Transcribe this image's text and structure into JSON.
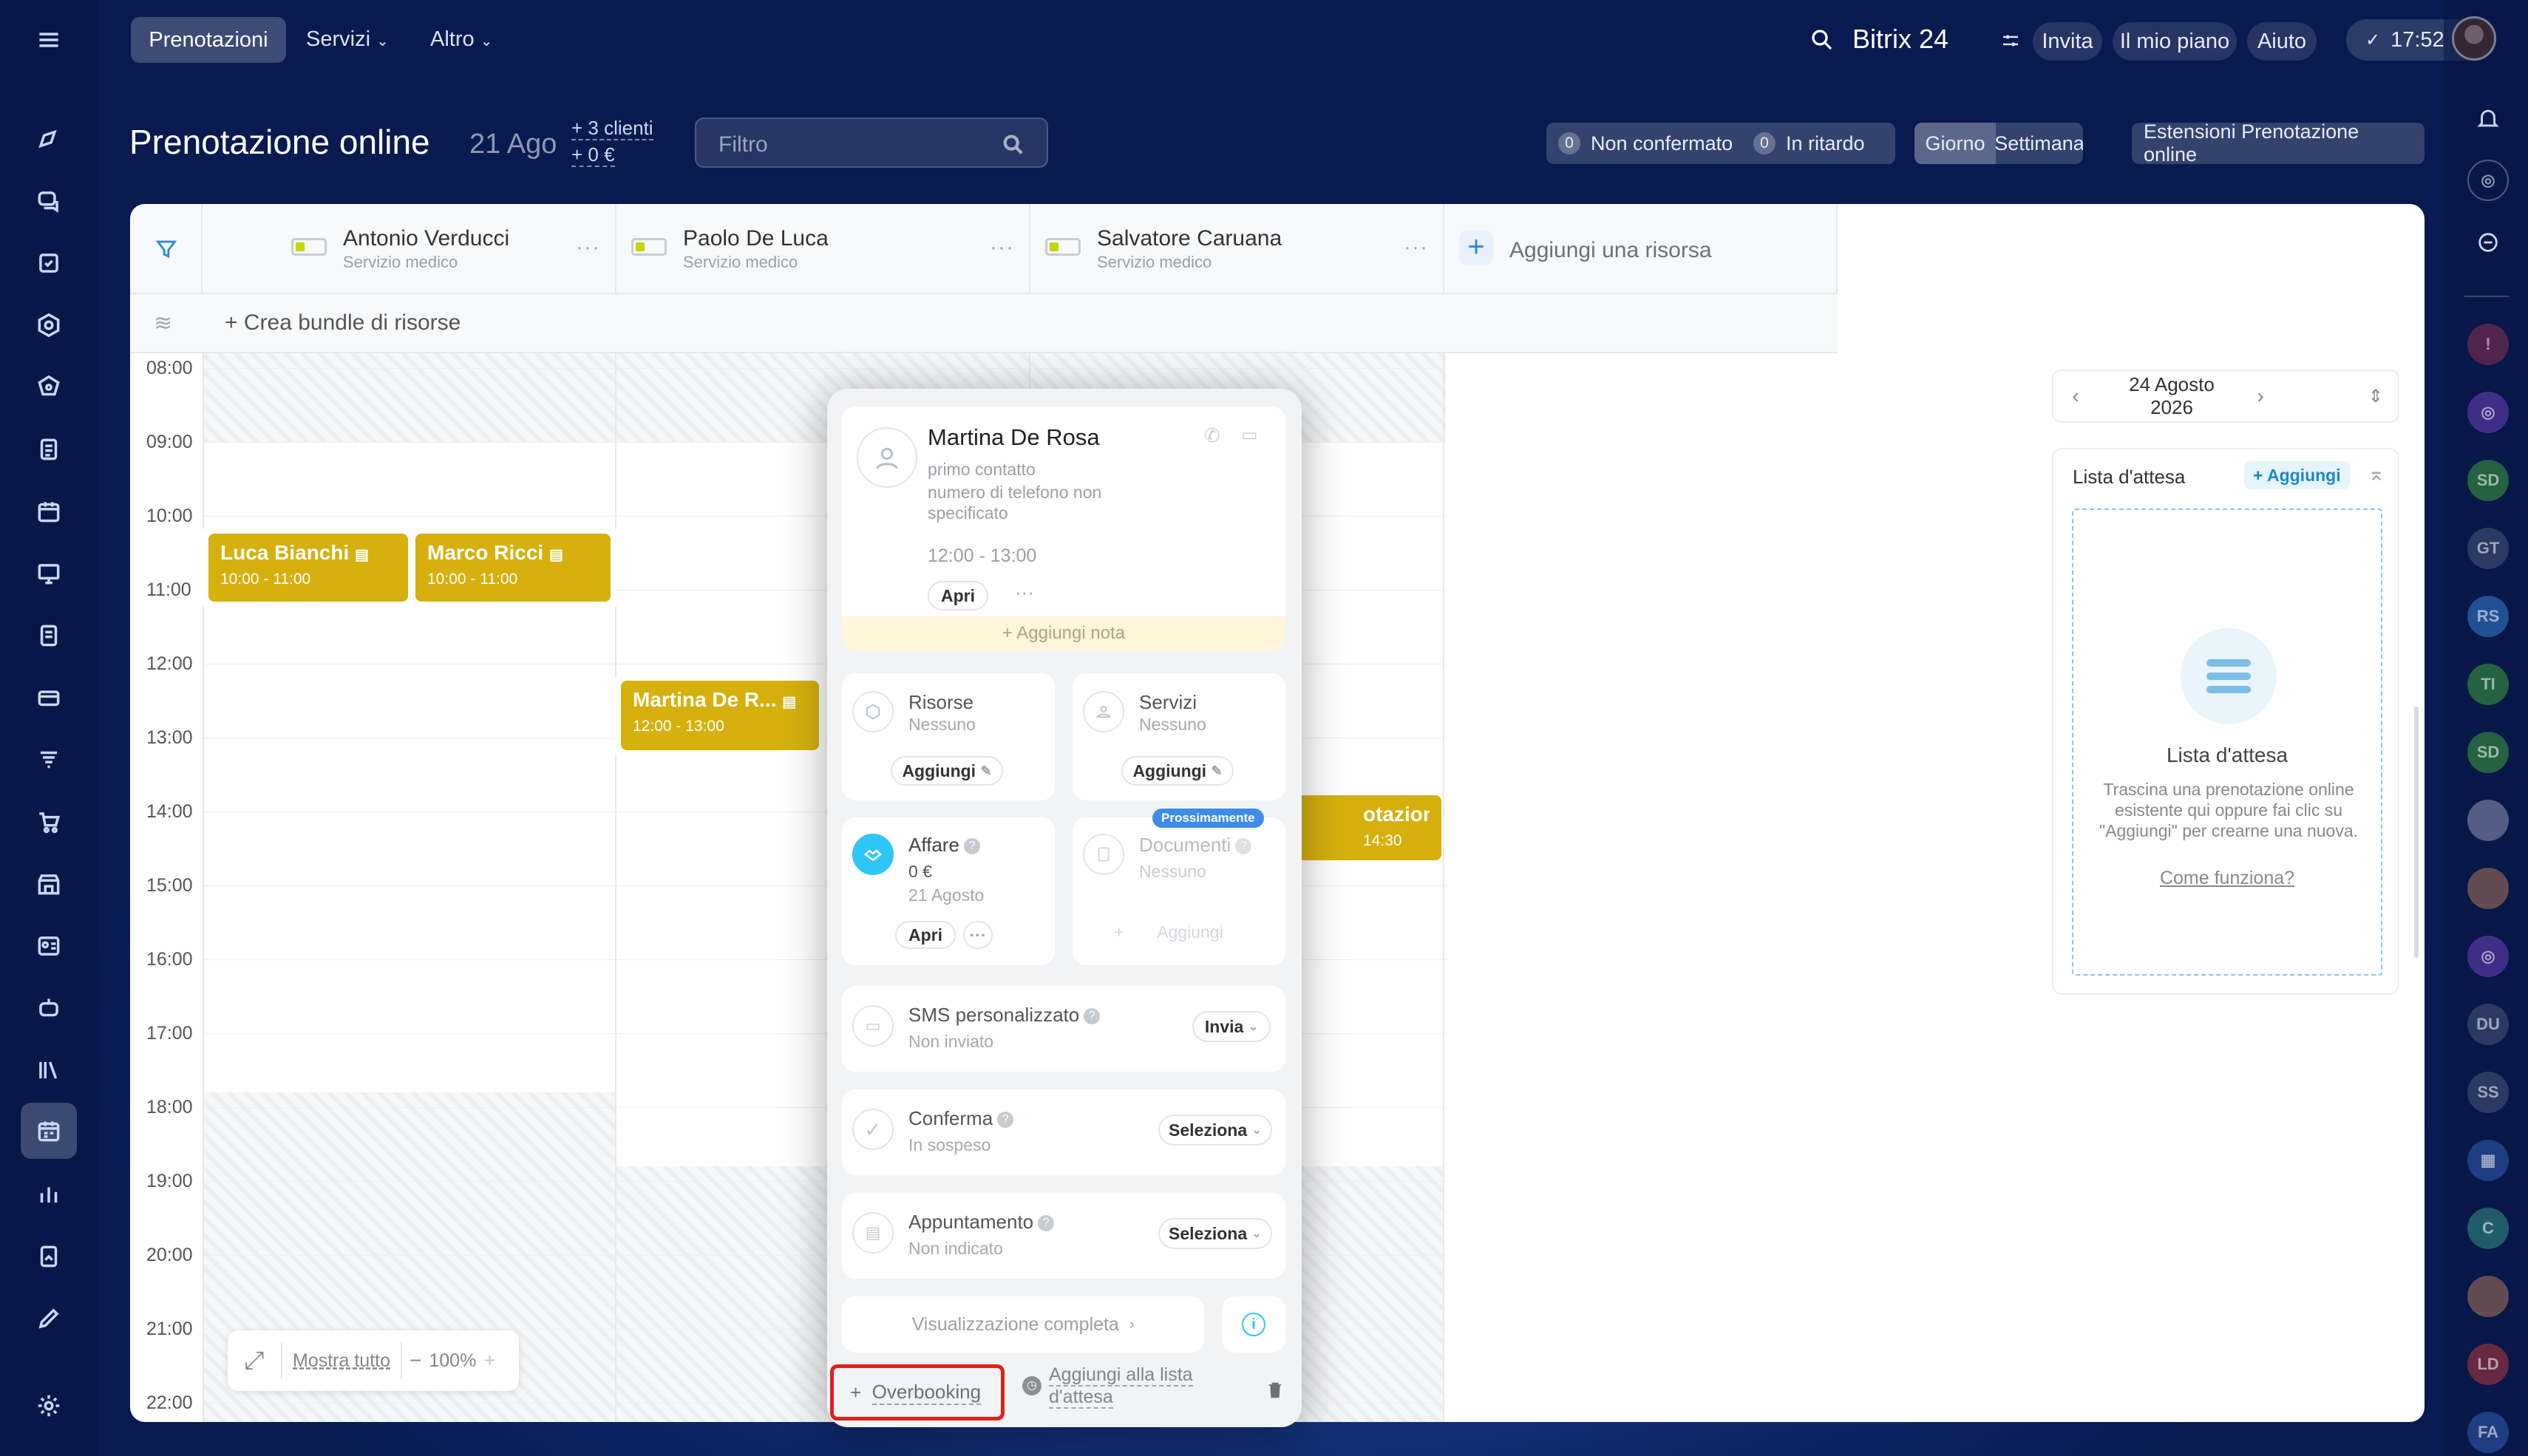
{
  "topnav": {
    "tabs": [
      "Prenotazioni",
      "Servizi",
      "Altro"
    ],
    "brand": "Bitrix 24",
    "invite": "Invita",
    "plan": "Il mio piano",
    "help": "Aiuto",
    "clock": "17:52"
  },
  "header": {
    "title": "Prenotazione online",
    "date": "21 Ago",
    "clients": "+ 3 clienti",
    "amount": "+ 0 €",
    "filter_placeholder": "Filtro",
    "unconfirmed_count": "0",
    "unconfirmed_label": "Non confermato",
    "late_count": "0",
    "late_label": "In ritardo",
    "view_day": "Giorno",
    "view_week": "Settimana",
    "extensions": "Estensioni Prenotazione online"
  },
  "resources": [
    {
      "name": "Antonio Verducci",
      "sub": "Servizio medico"
    },
    {
      "name": "Paolo De Luca",
      "sub": "Servizio medico"
    },
    {
      "name": "Salvatore Caruana",
      "sub": "Servizio medico"
    }
  ],
  "add_resource": "Aggiungi una risorsa",
  "bundle": "+ Crea bundle di risorse",
  "times": [
    "08:00",
    "09:00",
    "10:00",
    "11:00",
    "12:00",
    "13:00",
    "14:00",
    "15:00",
    "16:00",
    "17:00",
    "18:00",
    "19:00",
    "20:00",
    "21:00",
    "22:00"
  ],
  "events": [
    {
      "name": "Luca Bianchi",
      "time": "10:00 - 11:00"
    },
    {
      "name": "Marco Ricci",
      "time": "10:00 - 11:00"
    },
    {
      "name": "Martina De R...",
      "time": "12:00 - 13:00"
    },
    {
      "name": "otazione",
      "time": "14:30"
    }
  ],
  "zoom": {
    "show_all": "Mostra tutto",
    "minus": "−",
    "value": "100%",
    "plus": "+"
  },
  "side": {
    "date": "24 Agosto 2026",
    "waitlist_title": "Lista d'attesa",
    "waitlist_add": "+ Aggiungi",
    "empty_title": "Lista d'attesa",
    "empty_text": "Trascina una prenotazione online esistente qui oppure fai clic su \"Aggiungi\" per crearne una nuova.",
    "how": "Come funziona?"
  },
  "popup": {
    "client_name": "Martina De Rosa",
    "client_line1": "primo contatto",
    "client_line2": "numero di telefono non specificato",
    "client_time": "12:00 - 13:00",
    "open": "Apri",
    "more": "···",
    "add_note": "+ Aggiungi nota",
    "resources_title": "Risorse",
    "resources_value": "Nessuno",
    "resources_add": "Aggiungi",
    "services_title": "Servizi",
    "services_value": "Nessuno",
    "services_add": "Aggiungi",
    "deal_title": "Affare",
    "deal_amount": "0 €",
    "deal_date": "21 Agosto",
    "deal_open": "Apri",
    "docs_badge": "Prossimamente",
    "docs_title": "Documenti",
    "docs_value": "Nessuno",
    "docs_add": "Aggiungi",
    "sms_title": "SMS personalizzato",
    "sms_status": "Non inviato",
    "sms_action": "Invia",
    "confirm_title": "Conferma",
    "confirm_status": "In sospeso",
    "confirm_action": "Seleziona",
    "appt_title": "Appuntamento",
    "appt_status": "Non indicato",
    "appt_action": "Seleziona",
    "full_view": "Visualizzazione completa",
    "overbooking": "Overbooking",
    "waitlist_line1": "Aggiungi alla lista",
    "waitlist_line2": "d'attesa"
  },
  "right_avatars": [
    "SD",
    "GT",
    "RS",
    "TI",
    "SD",
    "DU",
    "SS",
    "C",
    "LD",
    "FA"
  ],
  "colors": {
    "event": "#d6b10d",
    "accent": "#2fc6f6",
    "highlight": "#e0201b"
  }
}
